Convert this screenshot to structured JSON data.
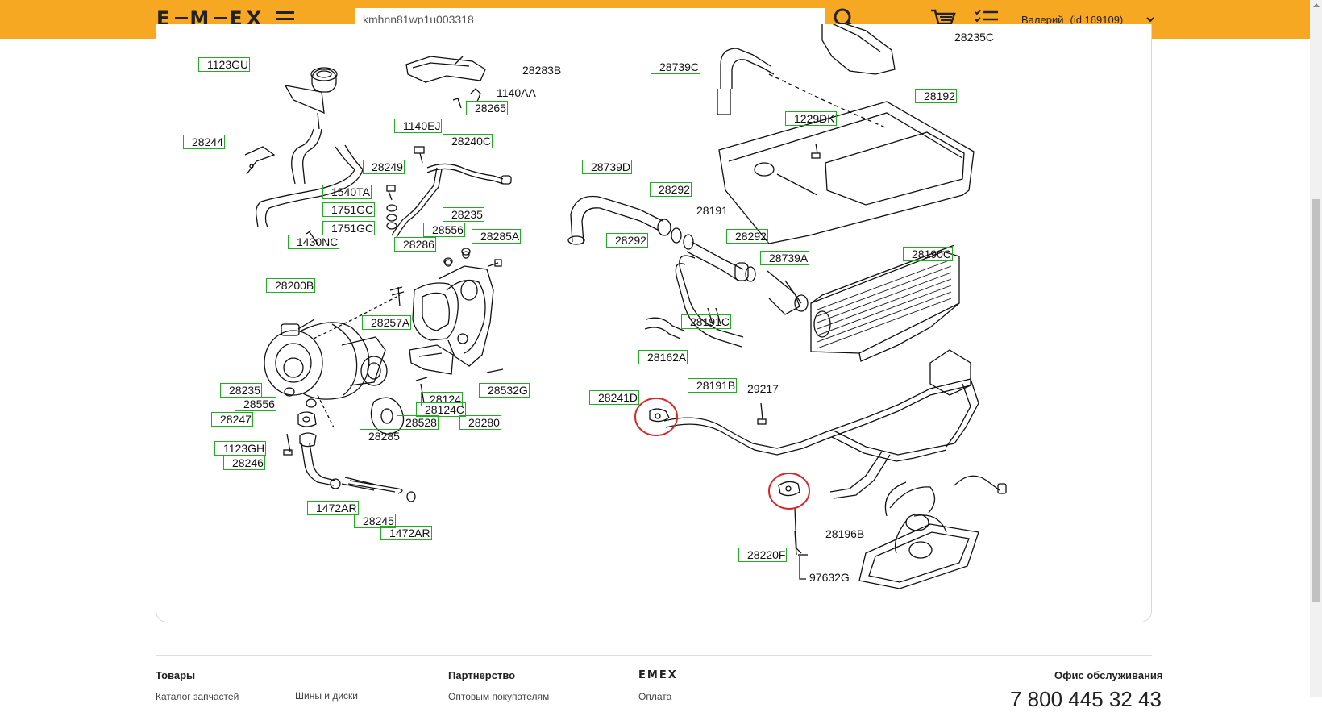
{
  "header": {
    "logo": "emex",
    "search_value": "kmhnn81wp1u003318",
    "user_name": "Валерий",
    "user_id": "(id 169109)",
    "icons": [
      "menu-icon",
      "search-icon",
      "cart-icon",
      "order-list-icon",
      "chevron-down-icon"
    ],
    "accent_color": "#f7a823"
  },
  "diagram": {
    "part_labels": [
      {
        "text": "1123GU",
        "boxed": true
      },
      {
        "text": "28283B",
        "boxed": false
      },
      {
        "text": "1140AA",
        "boxed": false
      },
      {
        "text": "28265",
        "boxed": true
      },
      {
        "text": "28244",
        "boxed": true
      },
      {
        "text": "1140EJ",
        "boxed": true
      },
      {
        "text": "28240C",
        "boxed": true
      },
      {
        "text": "28249",
        "boxed": true
      },
      {
        "text": "1540TA",
        "boxed": true
      },
      {
        "text": "1751GC",
        "boxed": true
      },
      {
        "text": "1751GC",
        "boxed": true
      },
      {
        "text": "1430NC",
        "boxed": true
      },
      {
        "text": "28235",
        "boxed": true
      },
      {
        "text": "28556",
        "boxed": true
      },
      {
        "text": "28285A",
        "boxed": true
      },
      {
        "text": "28286",
        "boxed": true
      },
      {
        "text": "28200B",
        "boxed": true
      },
      {
        "text": "28257A",
        "boxed": true
      },
      {
        "text": "28235",
        "boxed": true
      },
      {
        "text": "28556",
        "boxed": true
      },
      {
        "text": "28247",
        "boxed": true
      },
      {
        "text": "28124",
        "boxed": true
      },
      {
        "text": "28124C",
        "boxed": true
      },
      {
        "text": "28532G",
        "boxed": true
      },
      {
        "text": "28528",
        "boxed": true
      },
      {
        "text": "28280",
        "boxed": true
      },
      {
        "text": "28285",
        "boxed": true
      },
      {
        "text": "1123GH",
        "boxed": true
      },
      {
        "text": "28246",
        "boxed": true
      },
      {
        "text": "1472AR",
        "boxed": true
      },
      {
        "text": "28245",
        "boxed": true
      },
      {
        "text": "1472AR",
        "boxed": true
      },
      {
        "text": "28739C",
        "boxed": true
      },
      {
        "text": "28192",
        "boxed": true
      },
      {
        "text": "1229DK",
        "boxed": true
      },
      {
        "text": "28739D",
        "boxed": true
      },
      {
        "text": "28292",
        "boxed": true
      },
      {
        "text": "28191",
        "boxed": false
      },
      {
        "text": "28292",
        "boxed": true
      },
      {
        "text": "28292",
        "boxed": true
      },
      {
        "text": "28739A",
        "boxed": true
      },
      {
        "text": "28190C",
        "boxed": true
      },
      {
        "text": "28191C",
        "boxed": true
      },
      {
        "text": "28162A",
        "boxed": true
      },
      {
        "text": "28241D",
        "boxed": true
      },
      {
        "text": "28191B",
        "boxed": true
      },
      {
        "text": "29217",
        "boxed": false
      },
      {
        "text": "28196B",
        "boxed": false
      },
      {
        "text": "28220F",
        "boxed": true
      },
      {
        "text": "97632G",
        "boxed": false
      },
      {
        "text": "28235C",
        "boxed": false
      }
    ]
  },
  "footer": {
    "col1_head": "Товары",
    "col1_item1": "Каталог запчастей",
    "col1_item2": "Шины и диски",
    "col2_head": "Партнерство",
    "col2_item1": "Оптовым покупателям",
    "col3_head": "EMEX",
    "col3_item1": "Оплата",
    "col4_head": "Офис обслуживания",
    "phone": "7 800 445 32 43"
  }
}
